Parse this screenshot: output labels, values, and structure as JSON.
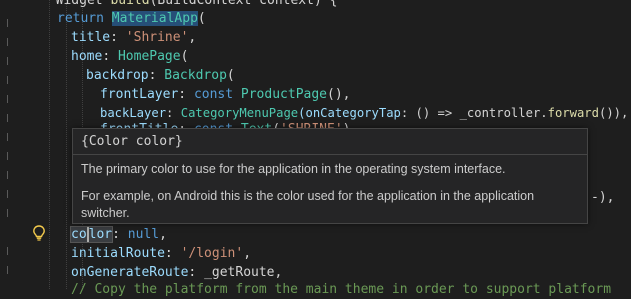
{
  "code": {
    "line0": {
      "t1": "  Widget ",
      "t2": "build",
      "t3": "(BuildContext context) {"
    },
    "line1": {
      "kw": "return",
      "cls": "MaterialApp",
      "p": "("
    },
    "line2": {
      "prop": "title",
      "p": ": ",
      "str": "'Shrine'",
      "end": ","
    },
    "line3": {
      "prop": "home",
      "p": ": ",
      "cls": "HomePage",
      "end": "("
    },
    "line4": {
      "prop": "backdrop",
      "p": ": ",
      "cls": "Backdrop",
      "end": "("
    },
    "line5": {
      "prop": "frontLayer",
      "p": ": ",
      "kw": "const",
      "cls": "ProductPage",
      "end": "(),"
    },
    "line6": {
      "prop": "backLayer",
      "p": ": ",
      "cls": "CategoryMenuPage",
      "arg": "(onCategoryTap",
      "mid": ": () => _controller.",
      "fn": "forward",
      "end": "()),"
    },
    "line7": {
      "prop": "frontTitle",
      "p": ": ",
      "kw": "const",
      "cls": "Text",
      "str": "'SHRINE'",
      "end": "),"
    },
    "line8_tail": "-),",
    "line11": {
      "prop_pre": "co",
      "prop_post": "lor",
      "p": ": ",
      "kw": "null",
      "end": ","
    },
    "line12": {
      "prop": "initialRoute",
      "p": ": ",
      "str": "'/login'",
      "end": ","
    },
    "line13": {
      "prop": "onGenerateRoute",
      "p": ": ",
      "val": "_getRoute",
      "end": ","
    },
    "line14": {
      "cmt": "// Copy the platform from the main theme in order to support platform"
    }
  },
  "hover": {
    "signature": "{Color color}",
    "description": "The primary color to use for the application in the operating system interface.",
    "example": "For example, on Android this is the color used for the application in the application switcher."
  },
  "icons": {
    "lightbulb": "lightbulb-icon"
  }
}
